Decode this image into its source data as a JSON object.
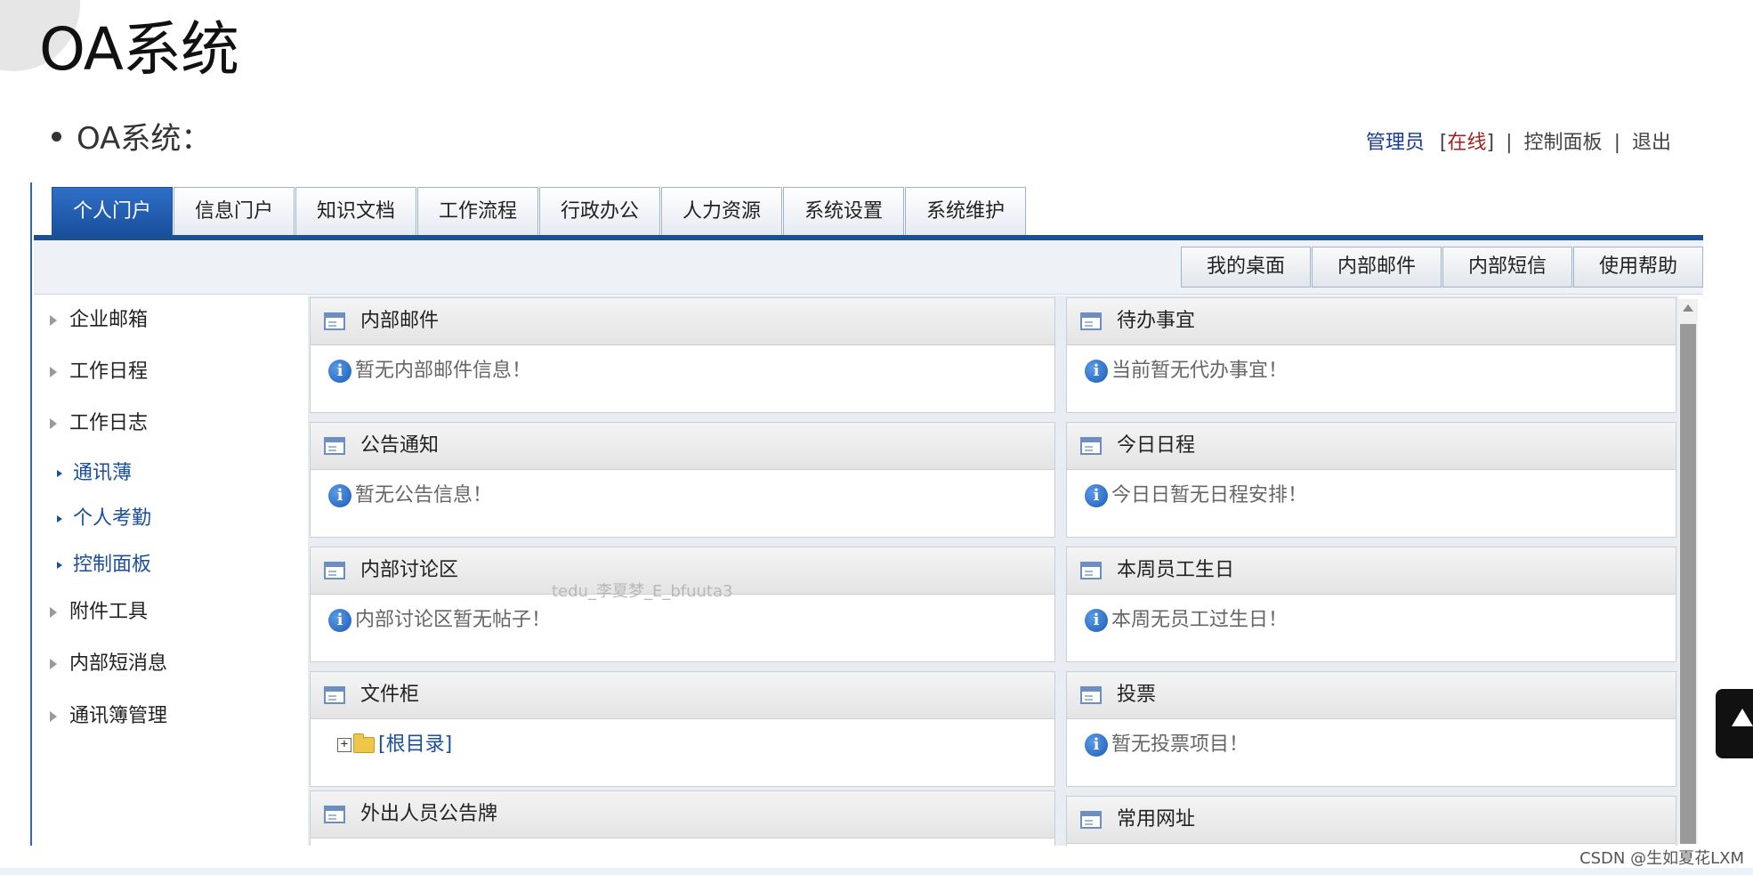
{
  "slide": {
    "title": "OA系统",
    "subtitle": "OA系统："
  },
  "userbar": {
    "user": "管理员",
    "status_open": "[",
    "status": "在线",
    "status_close": "]",
    "sep1": "|",
    "control_panel": "控制面板",
    "sep2": "|",
    "logout": "退出"
  },
  "tabs": [
    "个人门户",
    "信息门户",
    "知识文档",
    "工作流程",
    "行政办公",
    "人力资源",
    "系统设置",
    "系统维护"
  ],
  "toolbar": [
    "我的桌面",
    "内部邮件",
    "内部短信",
    "使用帮助"
  ],
  "sidebar": {
    "items": [
      "企业邮箱",
      "工作日程",
      "工作日志"
    ],
    "subitems": [
      "通讯薄",
      "个人考勤",
      "控制面板"
    ],
    "items2": [
      "附件工具",
      "内部短消息",
      "通讯簿管理"
    ]
  },
  "panels": {
    "mail": {
      "title": "内部邮件",
      "msg": "暂无内部邮件信息！"
    },
    "todo": {
      "title": "待办事宜",
      "msg": "当前暂无代办事宜！"
    },
    "notice": {
      "title": "公告通知",
      "msg": "暂无公告信息！"
    },
    "schedule": {
      "title": "今日日程",
      "msg": "今日日暂无日程安排！"
    },
    "forum": {
      "title": "内部讨论区",
      "msg": "内部讨论区暂无帖子！"
    },
    "birthday": {
      "title": "本周员工生日",
      "msg": "本周无员工过生日！"
    },
    "files": {
      "title": "文件柜",
      "root": "[根目录]"
    },
    "vote": {
      "title": "投票",
      "msg": "暂无投票项目！"
    },
    "outboard": {
      "title": "外出人员公告牌"
    },
    "links": {
      "title": "常用网址"
    }
  },
  "watermark": "tedu_李夏梦_E_bfuuta3",
  "credit": "CSDN @生如夏花LXM",
  "icons": {
    "info": "info-icon",
    "panel": "panel-icon",
    "folder": "folder-icon",
    "expand": "plus-box-icon"
  },
  "colors": {
    "tab_active": "#1a4f9c",
    "status_online": "#a02020",
    "link": "#1a4f9c"
  }
}
